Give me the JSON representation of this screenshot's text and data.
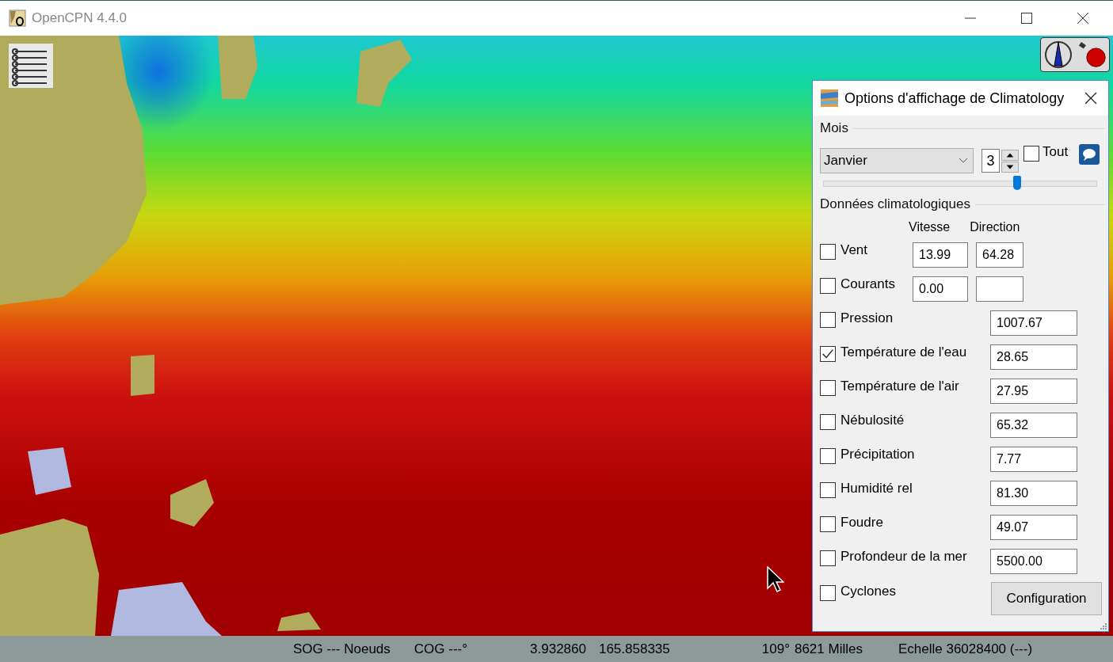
{
  "window": {
    "title": "OpenCPN 4.4.0"
  },
  "dialog": {
    "title": "Options d'affichage de Climatology",
    "month_section": {
      "label": "Mois",
      "month": "Janvier",
      "day": "3",
      "all": {
        "label": "Tout",
        "checked": false
      },
      "slider": {
        "level": 0.71
      }
    },
    "data_section": {
      "label": "Données climatologiques",
      "columns": [
        "Vitesse",
        "Direction"
      ],
      "rows": [
        {
          "kind": "pair",
          "label": "Vent",
          "checked": false,
          "values": [
            "13.99",
            "64.28"
          ]
        },
        {
          "kind": "pair",
          "label": "Courants",
          "checked": false,
          "values": [
            "0.00"
          ]
        },
        {
          "kind": "single",
          "label": "Pression",
          "checked": false,
          "values": [
            "1007.67"
          ]
        },
        {
          "kind": "single",
          "label": "Température de l'eau",
          "checked": true,
          "values": [
            "28.65"
          ]
        },
        {
          "kind": "single",
          "label": "Température de l'air",
          "checked": false,
          "values": [
            "27.95"
          ]
        },
        {
          "kind": "single",
          "label": "Nébulosité",
          "checked": false,
          "values": [
            "65.32"
          ]
        },
        {
          "kind": "single",
          "label": "Précipitation",
          "checked": false,
          "values": [
            "7.77"
          ]
        },
        {
          "kind": "single",
          "label": "Humidité rel",
          "checked": false,
          "values": [
            "81.30"
          ]
        },
        {
          "kind": "single",
          "label": "Foudre",
          "checked": false,
          "values": [
            "49.07"
          ]
        },
        {
          "kind": "single",
          "label": "Profondeur de la mer",
          "checked": false,
          "values": [
            "5500.00"
          ]
        },
        {
          "kind": "button",
          "label": "Cyclones",
          "checked": false,
          "button": "Configuration"
        }
      ]
    }
  },
  "status_bar": [
    "SOG --- Noeuds",
    "COG ---°",
    "3.932860",
    "165.858335",
    "109°",
    "8621 Milles",
    "Echelle 36028400 (---)"
  ]
}
